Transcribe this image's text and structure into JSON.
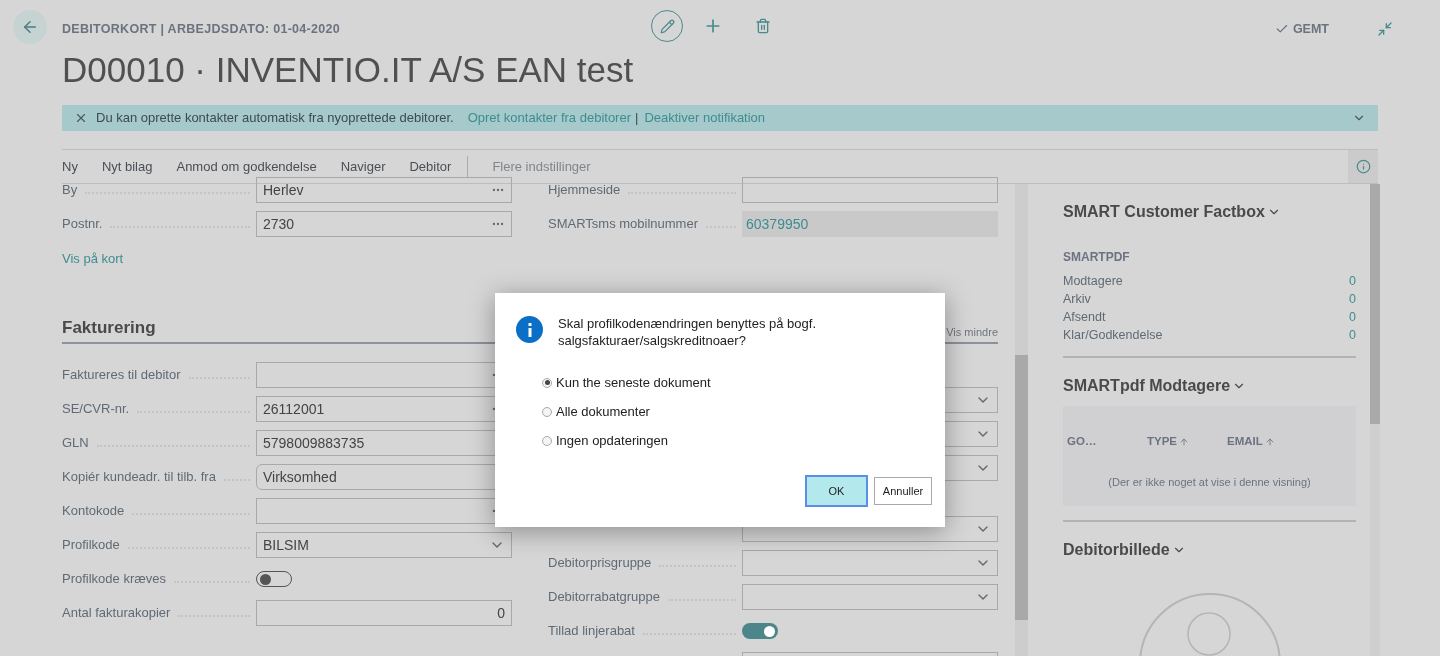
{
  "header": {
    "caption": "DEBITORKORT | ARBEJDSDATO: 01-04-2020",
    "title": "D00010 · INVENTIO.IT A/S EAN test",
    "status": "GEMT"
  },
  "notification": {
    "message": "Du kan oprette kontakter automatisk fra nyoprettede debitorer.",
    "links": [
      "Opret kontakter fra debitorer",
      "Deaktiver notifikation"
    ],
    "separator": "|"
  },
  "actions": [
    "Ny",
    "Nyt bilag",
    "Anmod om godkendelse",
    "Naviger",
    "Debitor"
  ],
  "more_actions": "Flere indstillinger",
  "general": {
    "left": [
      {
        "kind": "lookup",
        "label": "By",
        "value": "Herlev"
      },
      {
        "kind": "lookup",
        "label": "Postnr.",
        "value": "2730"
      }
    ],
    "link": "Vis på kort",
    "right": [
      {
        "kind": "text",
        "label": "Hjemmeside"
      },
      {
        "kind": "readonly",
        "label": "SMARTsms mobilnummer",
        "value": "60379950"
      }
    ]
  },
  "invoicing": {
    "title": "Fakturering",
    "toggle_link": "Vis mindre",
    "left": [
      {
        "kind": "lookup",
        "label": "Faktureres til debitor"
      },
      {
        "kind": "lookup",
        "label": "SE/CVR-nr.",
        "value": "26112001"
      },
      {
        "kind": "text",
        "label": "GLN",
        "value": "5798009883735"
      },
      {
        "kind": "option",
        "label": "Kopiér kundeadr. til tilb. fra",
        "value": "Virksomhed"
      },
      {
        "kind": "lookup",
        "label": "Kontokode"
      },
      {
        "kind": "dropdown",
        "label": "Profilkode",
        "value": "BILSIM"
      },
      {
        "kind": "toggle",
        "label": "Profilkode kræves",
        "on": false
      },
      {
        "kind": "number",
        "label": "Antal fakturakopier",
        "value": "0"
      }
    ],
    "right": [
      {
        "kind": "dropdown"
      },
      {
        "kind": "dropdown"
      },
      {
        "kind": "dropdown"
      },
      {
        "kind": "dropdown"
      },
      {
        "kind": "dropdown",
        "label": "Debitorprisgruppe"
      },
      {
        "kind": "dropdown",
        "label": "Debitorrabatgruppe"
      },
      {
        "kind": "toggle",
        "label": "Tillad linjerabat",
        "on": true
      },
      {
        "kind": "text"
      }
    ]
  },
  "factbox": {
    "title": "SMART Customer Factbox",
    "caption": "SMARTPDF",
    "rows": [
      {
        "label": "Modtagere",
        "value": "0"
      },
      {
        "label": "Arkiv",
        "value": "0"
      },
      {
        "label": "Afsendt",
        "value": "0"
      },
      {
        "label": "Klar/Godkendelse",
        "value": "0"
      }
    ]
  },
  "recipients": {
    "title": "SMARTpdf Modtagere",
    "columns": [
      {
        "label": "GO…",
        "sorted": false
      },
      {
        "label": "TYPE",
        "sorted": true
      },
      {
        "label": "EMAIL",
        "sorted": true
      }
    ],
    "empty": "(Der er ikke noget at vise i denne visning)"
  },
  "picture": {
    "title": "Debitorbillede"
  },
  "dialog": {
    "message": "Skal profilkodenændringen benyttes på bogf. salgsfakturaer/salgskreditnoaer?",
    "options": [
      {
        "label": "Kun the seneste dokument",
        "selected": true
      },
      {
        "label": "Alle dokumenter",
        "selected": false
      },
      {
        "label": "Ingen opdateringen",
        "selected": false
      }
    ],
    "buttons": [
      {
        "label": "OK",
        "kind": "primary"
      },
      {
        "label": "Annuller",
        "kind": "secondary"
      }
    ]
  }
}
